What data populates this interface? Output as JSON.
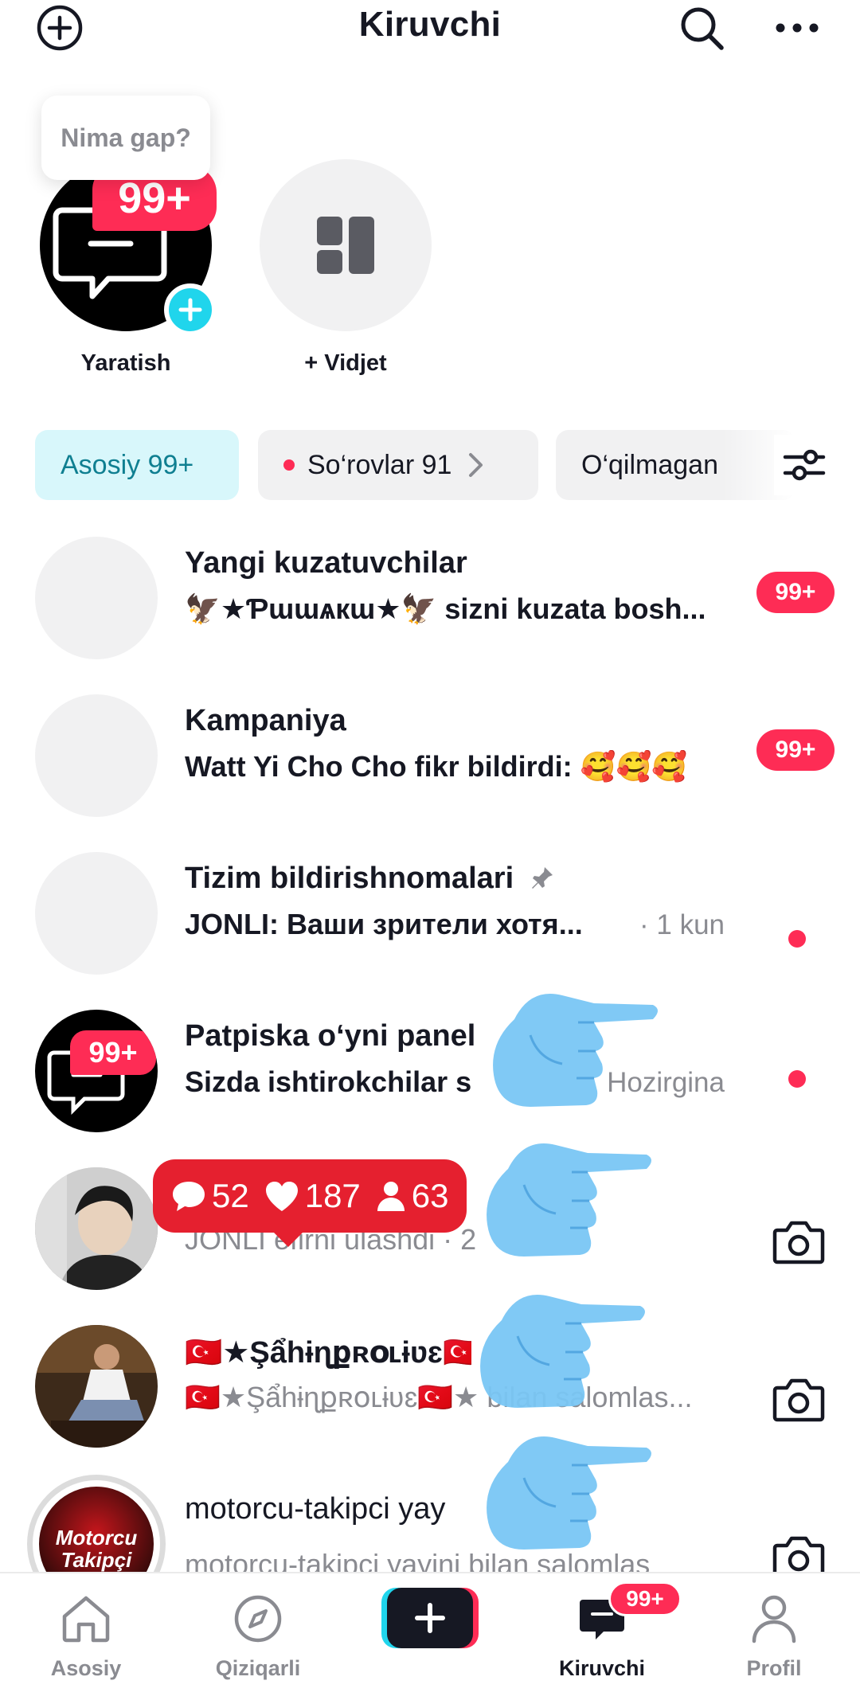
{
  "header": {
    "title": "Kiruvchi",
    "left_icon": "add-circle-icon",
    "right_icons": [
      "search-icon",
      "more-icon"
    ]
  },
  "tooltip": {
    "text": "Nima gap?"
  },
  "stories": [
    {
      "label": "Yaratish",
      "badge": "99+",
      "icon": "inbox-chat-icon"
    },
    {
      "label": "+ Vidjet",
      "icon": "widget-grid-icon"
    }
  ],
  "chips": {
    "active": "Asosiy 99+",
    "requests": "So‘rovlar 91",
    "unread": "O‘qilmagan"
  },
  "rows": [
    {
      "title": "Yangi kuzatuvchilar",
      "subtitle": "🦅★Ƥɯɯѧкɯ★🦅 sizni kuzata bosh...",
      "badge": "99+"
    },
    {
      "title": "Kampaniya",
      "subtitle": "Watt Yi Cho Cho fikr bildirdi: 🥰🥰🥰",
      "badge": "99+"
    },
    {
      "title": "Tizim bildirishnomalari",
      "subtitle": "JONLI: Ваши зрители хотя...",
      "time": "· 1 kun"
    },
    {
      "title": "Patpiska o‘yni panel",
      "subtitle": "Sizda ishtirokchilar s",
      "time": "Hozirgina",
      "badge_avatar": "99+"
    },
    {
      "title": "",
      "subtitle": "JONLI efirni ulashdi · 2"
    },
    {
      "title": "🇹🇷★Şẩhɨɳքʀօʟɨʋɛ🇹🇷",
      "subtitle": "🇹🇷★Şẩhɨɳքʀօʟɨʋɛ🇹🇷★ bilan salomlas..."
    },
    {
      "title": "motorcu-takipci yay",
      "subtitle": "motorcu-takipci yayini bilan salomlas",
      "avatar_text_1": "Motorcu",
      "avatar_text_2": "Takipçi"
    }
  ],
  "live_stats": {
    "comments": "52",
    "likes": "187",
    "viewers": "63"
  },
  "bottom_nav": [
    {
      "label": "Asosiy",
      "icon": "home-icon"
    },
    {
      "label": "Qiziqarli",
      "icon": "compass-icon"
    },
    {
      "label": "",
      "icon": "create-plus-icon"
    },
    {
      "label": "Kiruvchi",
      "icon": "inbox-icon",
      "badge": "99+"
    },
    {
      "label": "Profil",
      "icon": "profile-icon"
    }
  ],
  "colors": {
    "accent": "#fe2c55",
    "chip_active_bg": "#d8f7fb",
    "chip_active_text": "#0f7f91",
    "live_red": "#e5202f"
  }
}
